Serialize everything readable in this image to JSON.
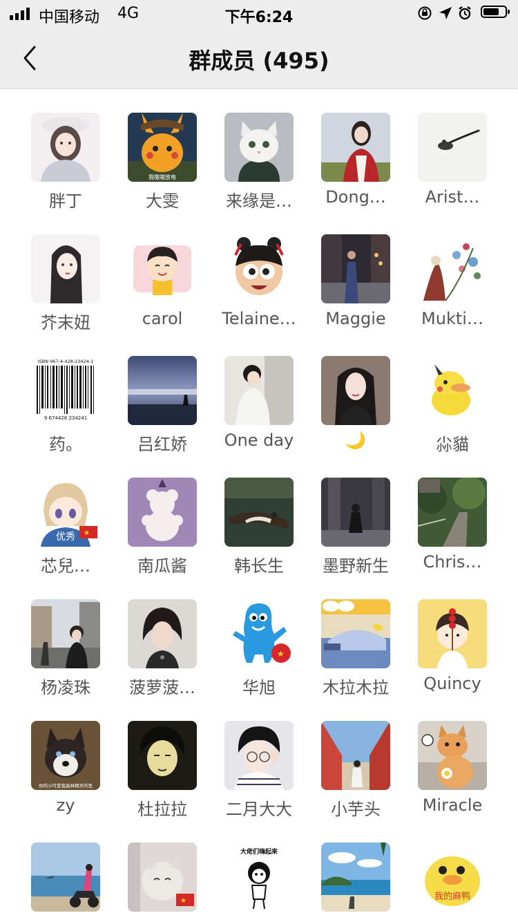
{
  "status": {
    "carrier": "中国移动",
    "network": "4G",
    "time": "下午6:24"
  },
  "nav": {
    "title": "群成员 (495)"
  },
  "members": [
    {
      "name": "胖丁",
      "avatar": "girl-hoodie"
    },
    {
      "name": "大雯",
      "avatar": "pikachu-detective"
    },
    {
      "name": "来缘是…",
      "avatar": "white-cat"
    },
    {
      "name": "Dong…",
      "avatar": "girl-red-scarf"
    },
    {
      "name": "Arist…",
      "avatar": "spoon"
    },
    {
      "name": "芥末妞",
      "avatar": "sketch-girl"
    },
    {
      "name": "carol",
      "avatar": "cartoon-boy"
    },
    {
      "name": "Telaine…",
      "avatar": "nezha"
    },
    {
      "name": "Maggie",
      "avatar": "street-photo"
    },
    {
      "name": "Mukti…",
      "avatar": "flower-art"
    },
    {
      "name": "药。",
      "avatar": "barcode"
    },
    {
      "name": "吕红娇",
      "avatar": "beach-dusk"
    },
    {
      "name": "One day",
      "avatar": "girl-white"
    },
    {
      "name": "🌙",
      "avatar": "girl-dark-hair"
    },
    {
      "name": "尛貓",
      "avatar": "psyduck-pikachu"
    },
    {
      "name": "芯兒…",
      "avatar": "anime-boy"
    },
    {
      "name": "南瓜酱",
      "avatar": "bear-purple"
    },
    {
      "name": "韩长生",
      "avatar": "boat-lake"
    },
    {
      "name": "墨野新生",
      "avatar": "dark-alley"
    },
    {
      "name": "Chris…",
      "avatar": "forest-stairs"
    },
    {
      "name": "杨凌珠",
      "avatar": "city-street"
    },
    {
      "name": "菠萝菠…",
      "avatar": "short-hair-girl"
    },
    {
      "name": "华旭",
      "avatar": "haibao"
    },
    {
      "name": "木拉木拉",
      "avatar": "cartoon-sleep"
    },
    {
      "name": "Quincy",
      "avatar": "boy-candy"
    },
    {
      "name": "zy",
      "avatar": "husky"
    },
    {
      "name": "杜拉拉",
      "avatar": "boy-sketch"
    },
    {
      "name": "二月大大",
      "avatar": "boy-glasses"
    },
    {
      "name": "小芋头",
      "avatar": "red-wall"
    },
    {
      "name": "Miracle",
      "avatar": "orange-cat"
    },
    {
      "name": "",
      "avatar": "motorbike-beach"
    },
    {
      "name": "",
      "avatar": "cat-flag"
    },
    {
      "name": "",
      "avatar": "meme-boss"
    },
    {
      "name": "",
      "avatar": "tropical-beach"
    },
    {
      "name": "",
      "avatar": "duck-meme"
    }
  ],
  "avatar_texts": {
    "pikachu_caption": "我嗷嗷放电",
    "isbn": "ISBN 967-4-428-23424-1",
    "barcode_digits": "9  674428  234241",
    "anime_text": "优秀",
    "husky_caption": "你的小可爱我森林精灵的思",
    "meme_text": "大佬们嗨起来",
    "duck_text": "我的麻鸭"
  },
  "colors": {
    "nav_bg": "#ededed",
    "name_text": "#555555",
    "title_text": "#111111"
  }
}
